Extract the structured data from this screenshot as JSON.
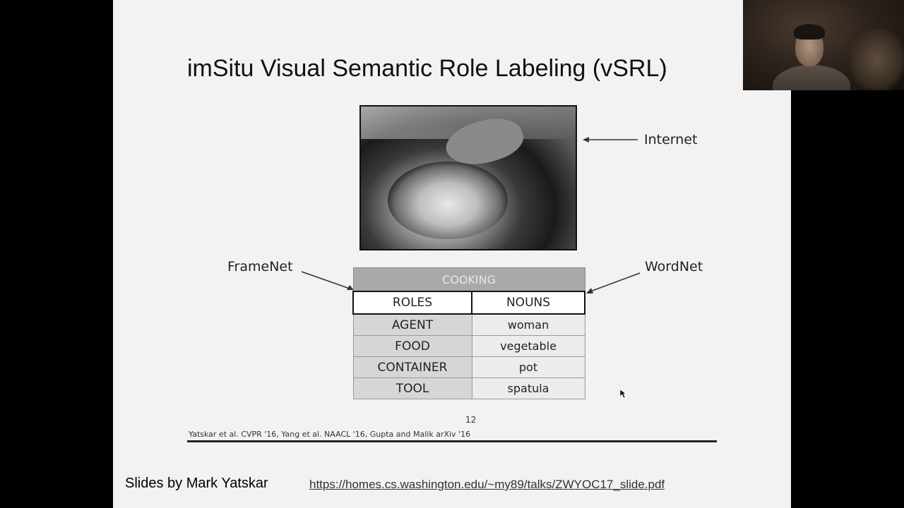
{
  "slide": {
    "title": "imSitu Visual Semantic Role Labeling (vSRL)",
    "photo_label": "Internet",
    "left_label": "FrameNet",
    "right_label": "WordNet",
    "table": {
      "frame": "COOKING",
      "columns": [
        "ROLES",
        "NOUNS"
      ],
      "rows": [
        {
          "role": "AGENT",
          "noun": "woman"
        },
        {
          "role": "FOOD",
          "noun": "vegetable"
        },
        {
          "role": "CONTAINER",
          "noun": "pot"
        },
        {
          "role": "TOOL",
          "noun": "spatula"
        }
      ]
    },
    "page_number": "12",
    "citation": "Yatskar et al. CVPR '16, Yang et al. NAACL '16, Gupta and Malik arXiv '16"
  },
  "footer": {
    "credit": "Slides by Mark Yatskar",
    "link": "https://homes.cs.washington.edu/~my89/talks/ZWYOC17_slide.pdf"
  },
  "icons": {
    "cursor": "mouse-pointer-icon",
    "arrows": "arrow-left-icon"
  }
}
